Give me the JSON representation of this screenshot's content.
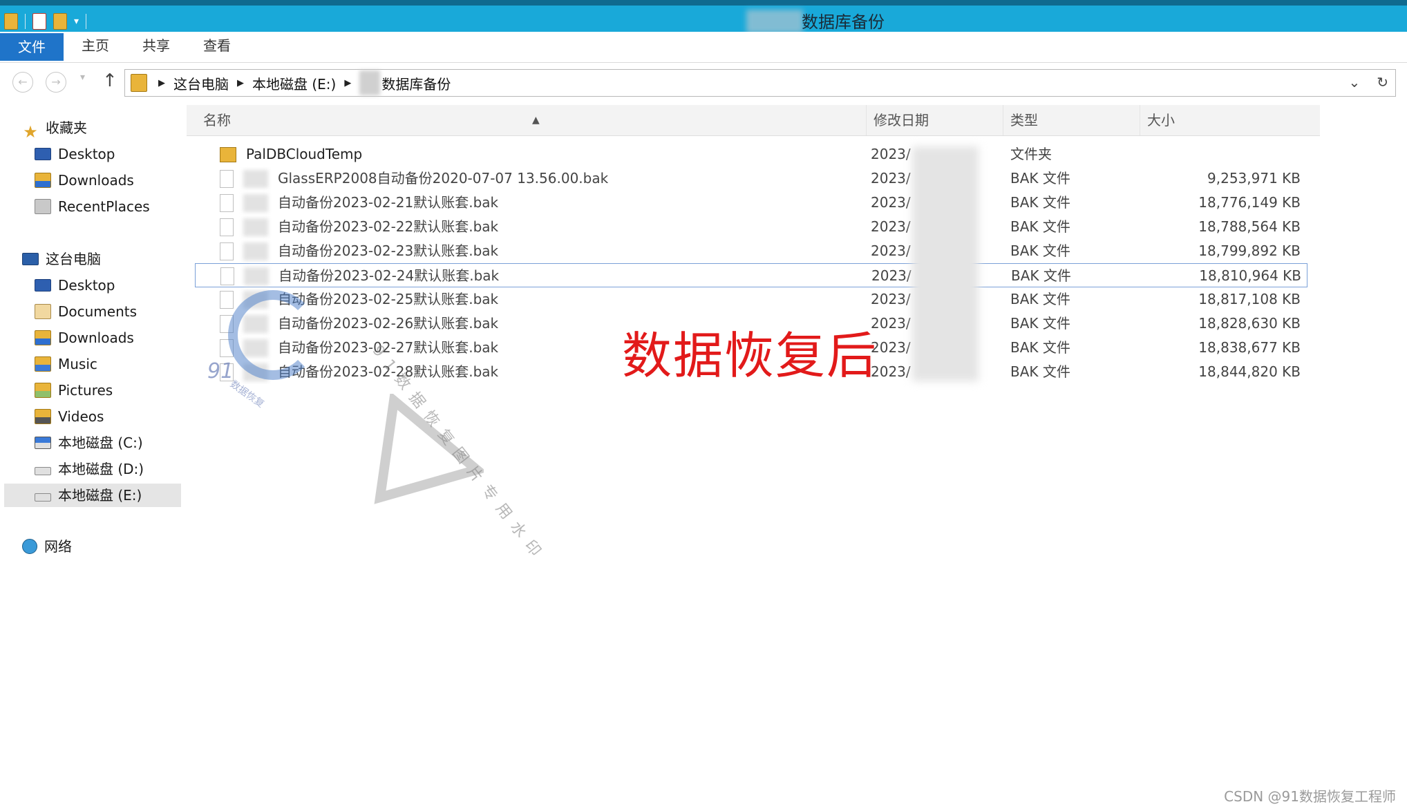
{
  "window": {
    "title": "数据库备份"
  },
  "ribbon": {
    "tabs": [
      "文件",
      "主页",
      "共享",
      "查看"
    ]
  },
  "address": {
    "crumbs": [
      "这台电脑",
      "本地磁盘 (E:)",
      "数据库备份"
    ]
  },
  "nav": {
    "favorites": "收藏夹",
    "fav_items": [
      "Desktop",
      "Downloads",
      "RecentPlaces"
    ],
    "this_pc": "这台电脑",
    "pc_items": [
      "Desktop",
      "Documents",
      "Downloads",
      "Music",
      "Pictures",
      "Videos",
      "本地磁盘 (C:)",
      "本地磁盘 (D:)",
      "本地磁盘 (E:)"
    ],
    "network": "网络"
  },
  "columns": {
    "name": "名称",
    "date": "修改日期",
    "type": "类型",
    "size": "大小"
  },
  "files": [
    {
      "name": "PalDBCloudTemp",
      "date": "2023/",
      "type": "文件夹",
      "size": ""
    },
    {
      "name": "GlassERP2008自动备份2020-07-07 13.56.00.bak",
      "date": "2023/",
      "type": "BAK 文件",
      "size": "9,253,971 KB"
    },
    {
      "name": "自动备份2023-02-21默认账套.bak",
      "date": "2023/",
      "type": "BAK 文件",
      "size": "18,776,149 KB"
    },
    {
      "name": "自动备份2023-02-22默认账套.bak",
      "date": "2023/",
      "type": "BAK 文件",
      "size": "18,788,564 KB"
    },
    {
      "name": "自动备份2023-02-23默认账套.bak",
      "date": "2023/",
      "type": "BAK 文件",
      "size": "18,799,892 KB"
    },
    {
      "name": "自动备份2023-02-24默认账套.bak",
      "date": "2023/",
      "type": "BAK 文件",
      "size": "18,810,964 KB"
    },
    {
      "name": "自动备份2023-02-25默认账套.bak",
      "date": "2023/",
      "type": "BAK 文件",
      "size": "18,817,108 KB"
    },
    {
      "name": "自动备份2023-02-26默认账套.bak",
      "date": "2023/",
      "type": "BAK 文件",
      "size": "18,828,630 KB"
    },
    {
      "name": "自动备份2023-02-27默认账套.bak",
      "date": "2023/",
      "type": "BAK 文件",
      "size": "18,838,677 KB"
    },
    {
      "name": "自动备份2023-02-28默认账套.bak",
      "date": "2023/",
      "type": "BAK 文件",
      "size": "18,844,820 KB"
    }
  ],
  "overlay": "数据恢复后",
  "watermark": {
    "logo": "91",
    "logo_sub": "数据恢复",
    "text": "91数据恢复图片专用水印"
  },
  "credit": "CSDN @91数据恢复工程师",
  "colors": {
    "titlebar": "#19a9d9",
    "file_tab": "#1f74c9",
    "overlay_text": "#e21a1a"
  }
}
